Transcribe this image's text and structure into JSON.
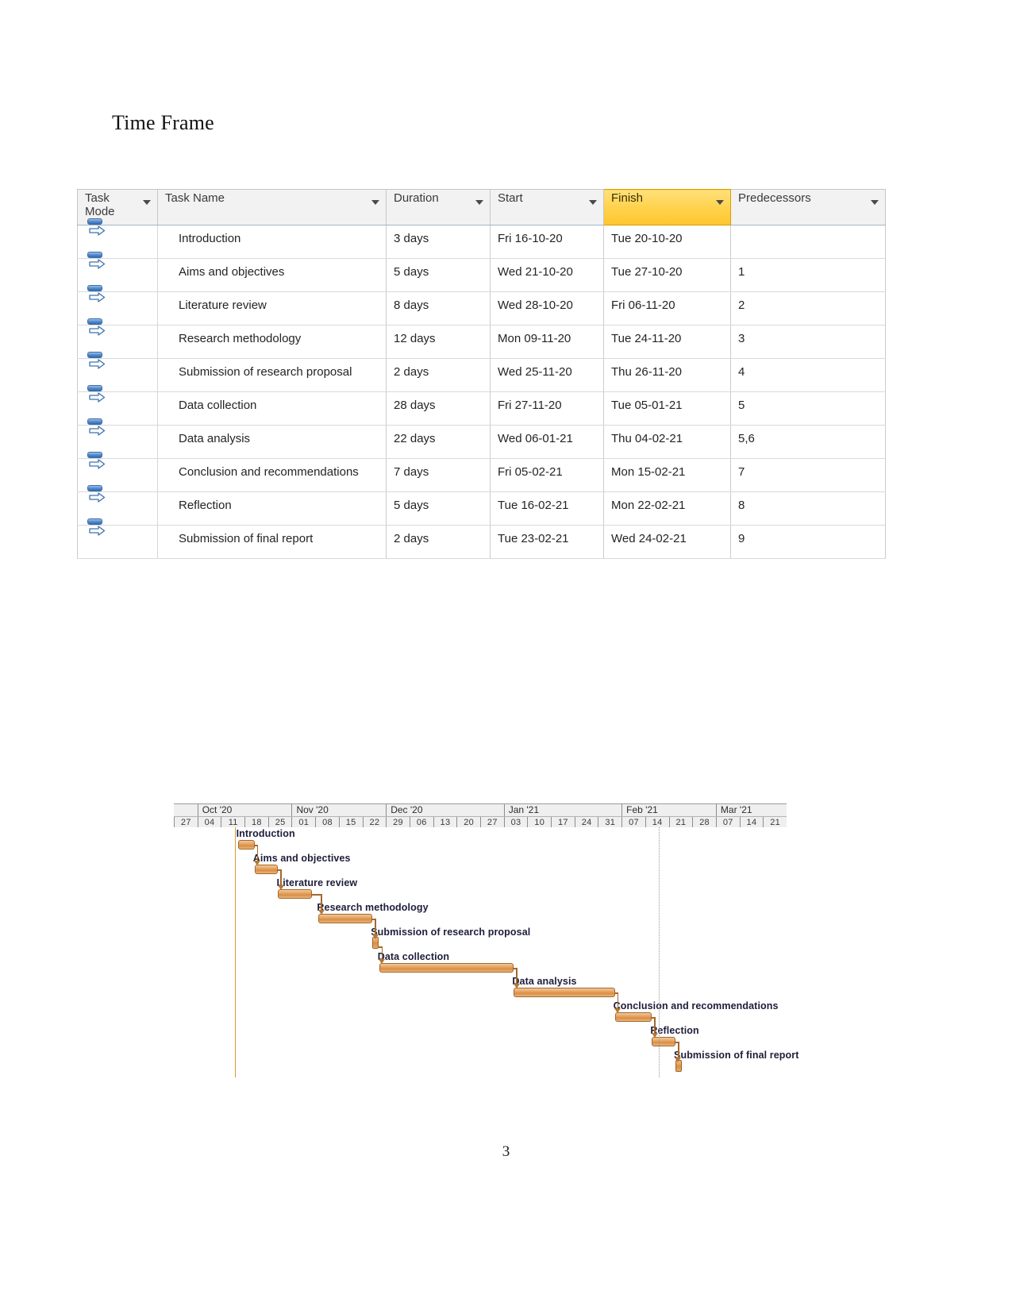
{
  "document": {
    "heading": "Time Frame",
    "page_number": "3"
  },
  "table": {
    "columns": [
      {
        "key": "task_mode",
        "label": "Task Mode",
        "filter_icon": "chevron-down-icon",
        "highlighted": false
      },
      {
        "key": "task_name",
        "label": "Task Name",
        "filter_icon": "chevron-down-icon",
        "highlighted": false
      },
      {
        "key": "duration",
        "label": "Duration",
        "filter_icon": "chevron-down-icon",
        "highlighted": false
      },
      {
        "key": "start",
        "label": "Start",
        "filter_icon": "chevron-down-icon",
        "highlighted": false
      },
      {
        "key": "finish",
        "label": "Finish",
        "filter_icon": "chevron-down-icon",
        "highlighted": true
      },
      {
        "key": "predecessors",
        "label": "Predecessors",
        "filter_icon": "chevron-down-icon",
        "highlighted": false
      }
    ],
    "highlight_color": "#ffd14a",
    "rows": [
      {
        "mode_icon": "auto-schedule-icon",
        "task_name": "Introduction",
        "duration": "3 days",
        "start": "Fri 16-10-20",
        "finish": "Tue 20-10-20",
        "predecessors": ""
      },
      {
        "mode_icon": "auto-schedule-icon",
        "task_name": "Aims and objectives",
        "duration": "5 days",
        "start": "Wed 21-10-20",
        "finish": "Tue 27-10-20",
        "predecessors": "1"
      },
      {
        "mode_icon": "auto-schedule-icon",
        "task_name": "Literature review",
        "duration": "8 days",
        "start": "Wed 28-10-20",
        "finish": "Fri 06-11-20",
        "predecessors": "2"
      },
      {
        "mode_icon": "auto-schedule-icon",
        "task_name": "Research methodology",
        "duration": "12 days",
        "start": "Mon 09-11-20",
        "finish": "Tue 24-11-20",
        "predecessors": "3"
      },
      {
        "mode_icon": "auto-schedule-icon",
        "task_name": "Submission of research proposal",
        "duration": "2 days",
        "start": "Wed 25-11-20",
        "finish": "Thu 26-11-20",
        "predecessors": "4"
      },
      {
        "mode_icon": "auto-schedule-icon",
        "task_name": "Data collection",
        "duration": "28 days",
        "start": "Fri 27-11-20",
        "finish": "Tue 05-01-21",
        "predecessors": "5"
      },
      {
        "mode_icon": "auto-schedule-icon",
        "task_name": "Data analysis",
        "duration": "22 days",
        "start": "Wed 06-01-21",
        "finish": "Thu 04-02-21",
        "predecessors": "5,6"
      },
      {
        "mode_icon": "auto-schedule-icon",
        "task_name": "Conclusion and recommendations",
        "duration": "7 days",
        "start": "Fri 05-02-21",
        "finish": "Mon 15-02-21",
        "predecessors": "7"
      },
      {
        "mode_icon": "auto-schedule-icon",
        "task_name": "Reflection",
        "duration": "5 days",
        "start": "Tue 16-02-21",
        "finish": "Mon 22-02-21",
        "predecessors": "8"
      },
      {
        "mode_icon": "auto-schedule-icon",
        "task_name": "Submission of final report",
        "duration": "2 days",
        "start": "Tue 23-02-21",
        "finish": "Wed 24-02-21",
        "predecessors": "9"
      }
    ]
  },
  "chart_data": {
    "type": "bar",
    "title": "Time Frame",
    "orientation": "horizontal-gantt",
    "xlabel": "",
    "ylabel": "",
    "bar_color": "#d98e43",
    "link_color": "#a4682a",
    "axis": {
      "months": [
        "Oct '20",
        "Nov '20",
        "Dec '20",
        "Jan '21",
        "Feb '21",
        "Mar '21"
      ],
      "week_ticks": [
        "27",
        "04",
        "11",
        "18",
        "25",
        "01",
        "08",
        "15",
        "22",
        "29",
        "06",
        "13",
        "20",
        "27",
        "03",
        "10",
        "17",
        "24",
        "31",
        "07",
        "14",
        "21",
        "28",
        "07",
        "14",
        "21"
      ],
      "tick_unit": "week-starting-day",
      "range_start": "2020-09-27",
      "range_end": "2021-03-21"
    },
    "tasks": [
      {
        "name": "Introduction",
        "start": "Fri 16-10-20",
        "finish": "Tue 20-10-20",
        "duration_days": 3,
        "predecessors": "",
        "milestone": false
      },
      {
        "name": "Aims and objectives",
        "start": "Wed 21-10-20",
        "finish": "Tue 27-10-20",
        "duration_days": 5,
        "predecessors": "1",
        "milestone": false
      },
      {
        "name": "Literature review",
        "start": "Wed 28-10-20",
        "finish": "Fri 06-11-20",
        "duration_days": 8,
        "predecessors": "2",
        "milestone": false
      },
      {
        "name": "Research methodology",
        "start": "Mon 09-11-20",
        "finish": "Tue 24-11-20",
        "duration_days": 12,
        "predecessors": "3",
        "milestone": false
      },
      {
        "name": "Submission of research proposal",
        "start": "Wed 25-11-20",
        "finish": "Thu 26-11-20",
        "duration_days": 2,
        "predecessors": "4",
        "milestone": true
      },
      {
        "name": "Data collection",
        "start": "Fri 27-11-20",
        "finish": "Tue 05-01-21",
        "duration_days": 28,
        "predecessors": "5",
        "milestone": false
      },
      {
        "name": "Data analysis",
        "start": "Wed 06-01-21",
        "finish": "Thu 04-02-21",
        "duration_days": 22,
        "predecessors": "5,6",
        "milestone": false
      },
      {
        "name": "Conclusion and recommendations",
        "start": "Fri 05-02-21",
        "finish": "Mon 15-02-21",
        "duration_days": 7,
        "predecessors": "7",
        "milestone": false
      },
      {
        "name": "Reflection",
        "start": "Tue 16-02-21",
        "finish": "Mon 22-02-21",
        "duration_days": 5,
        "predecessors": "8",
        "milestone": false
      },
      {
        "name": "Submission of final report",
        "start": "Tue 23-02-21",
        "finish": "Wed 24-02-21",
        "duration_days": 2,
        "predecessors": "9",
        "milestone": true
      }
    ]
  }
}
